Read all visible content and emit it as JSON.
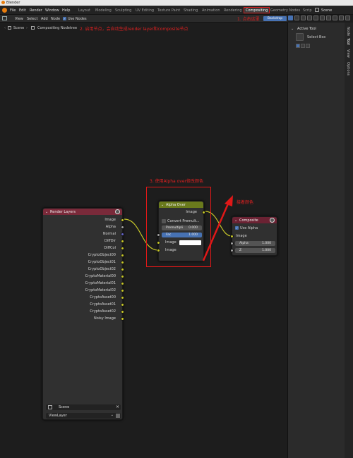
{
  "window": {
    "title": "Blender"
  },
  "topbar": {
    "menus": [
      "File",
      "Edit",
      "Render",
      "Window",
      "Help"
    ],
    "workspaces": [
      "Layout",
      "Modeling",
      "Sculpting",
      "UV Editing",
      "Texture Paint",
      "Shading",
      "Animation",
      "Rendering",
      "Compositing",
      "Geometry Nodes",
      "Scrip"
    ],
    "active_workspace": "Compositing",
    "scene": "Scene"
  },
  "node_header": {
    "menus": [
      "View",
      "Select",
      "Add",
      "Node"
    ],
    "use_nodes_label": "Use Nodes",
    "backdrop_label": "Backdrop"
  },
  "annotation_1": "1. 点击这里",
  "breadcrumb": {
    "scene": "Scene",
    "tree": "Compositing Nodetree"
  },
  "annotation_2": "2. 启用节点，会自动生成render layer和composite节点",
  "annotation_3": "3. 使用Alpha over修改颜色",
  "annotation_4": "接着颜色",
  "sidebar": {
    "section_title": "Active Tool",
    "tool_name": "Select Box",
    "tabs": [
      "Node",
      "Tool",
      "View",
      "Options"
    ]
  },
  "render_layers_node": {
    "title": "Render Layers",
    "outputs": [
      "Image",
      "Alpha",
      "Normal",
      "DiffDir",
      "DiffCol",
      "CryptoObject00",
      "CryptoObject01",
      "CryptoObject02",
      "CryptoMaterial00",
      "CryptoMaterial01",
      "CryptoMaterial02",
      "CryptoAsset00",
      "CryptoAsset01",
      "CryptoAsset02",
      "Noisy Image"
    ],
    "scene": "Scene",
    "view_layer": "ViewLayer"
  },
  "alpha_over_node": {
    "title": "Alpha Over",
    "output": "Image",
    "convert_label": "Convert Premult...",
    "premul_label": "Premultipli",
    "premul_value": "0.000",
    "fac_label": "Fac",
    "fac_value": "1.000",
    "input1": "Image",
    "input2": "Image"
  },
  "composite_node": {
    "title": "Composite",
    "use_alpha": "Use Alpha",
    "image": "Image",
    "alpha_label": "Alpha",
    "alpha_value": "1.000",
    "z_label": "Z",
    "z_value": "1.000"
  },
  "colors": {
    "render_layers_header": "#7a2a3a",
    "alpha_over_header": "#6a7a1c",
    "composite_header": "#6b2233",
    "annotation": "#e02020"
  }
}
